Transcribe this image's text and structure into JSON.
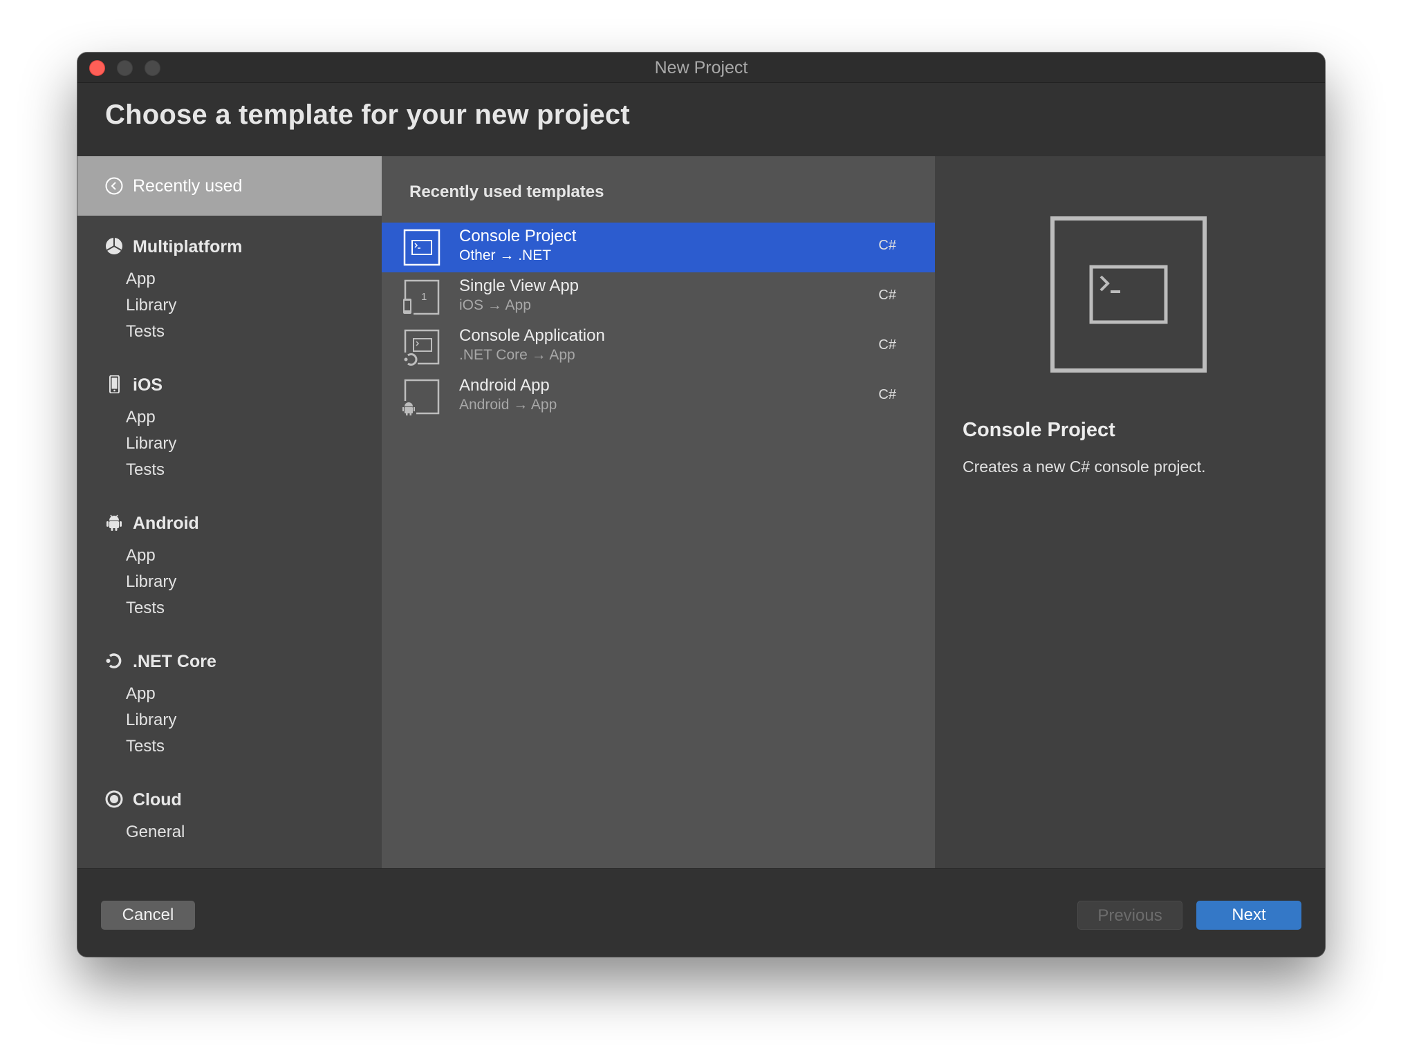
{
  "window": {
    "title": "New Project"
  },
  "header": {
    "title": "Choose a template for your new project"
  },
  "sidebar": {
    "selected": {
      "label": "Recently used",
      "icon": "clock-icon"
    },
    "categories": [
      {
        "label": "Multiplatform",
        "icon": "multiplatform-icon",
        "items": [
          "App",
          "Library",
          "Tests"
        ]
      },
      {
        "label": "iOS",
        "icon": "phone-icon",
        "items": [
          "App",
          "Library",
          "Tests"
        ]
      },
      {
        "label": "Android",
        "icon": "android-icon",
        "items": [
          "App",
          "Library",
          "Tests"
        ]
      },
      {
        "label": ".NET Core",
        "icon": "dotnet-core-icon",
        "items": [
          "App",
          "Library",
          "Tests"
        ]
      },
      {
        "label": "Cloud",
        "icon": "cloud-icon",
        "items": [
          "General"
        ]
      }
    ]
  },
  "templates": {
    "title": "Recently used templates",
    "items": [
      {
        "name": "Console Project",
        "path": "Other → .NET",
        "lang": "C#",
        "icon": "console-template-icon",
        "selected": true
      },
      {
        "name": "Single View App",
        "path": "iOS → App",
        "lang": "C#",
        "icon": "ios-app-template-icon",
        "selected": false
      },
      {
        "name": "Console Application",
        "path": ".NET Core → App",
        "lang": "C#",
        "icon": "dotnet-console-template-icon",
        "selected": false
      },
      {
        "name": "Android App",
        "path": "Android → App",
        "lang": "C#",
        "icon": "android-app-template-icon",
        "selected": false
      }
    ]
  },
  "details": {
    "title": "Console Project",
    "description": "Creates a new C# console project.",
    "icon": "console-preview-icon"
  },
  "footer": {
    "cancel": "Cancel",
    "previous": "Previous",
    "next": "Next"
  },
  "colors": {
    "selection": "#2c5ccf",
    "next_button": "#3478c7",
    "close_button": "#fe5f57"
  }
}
